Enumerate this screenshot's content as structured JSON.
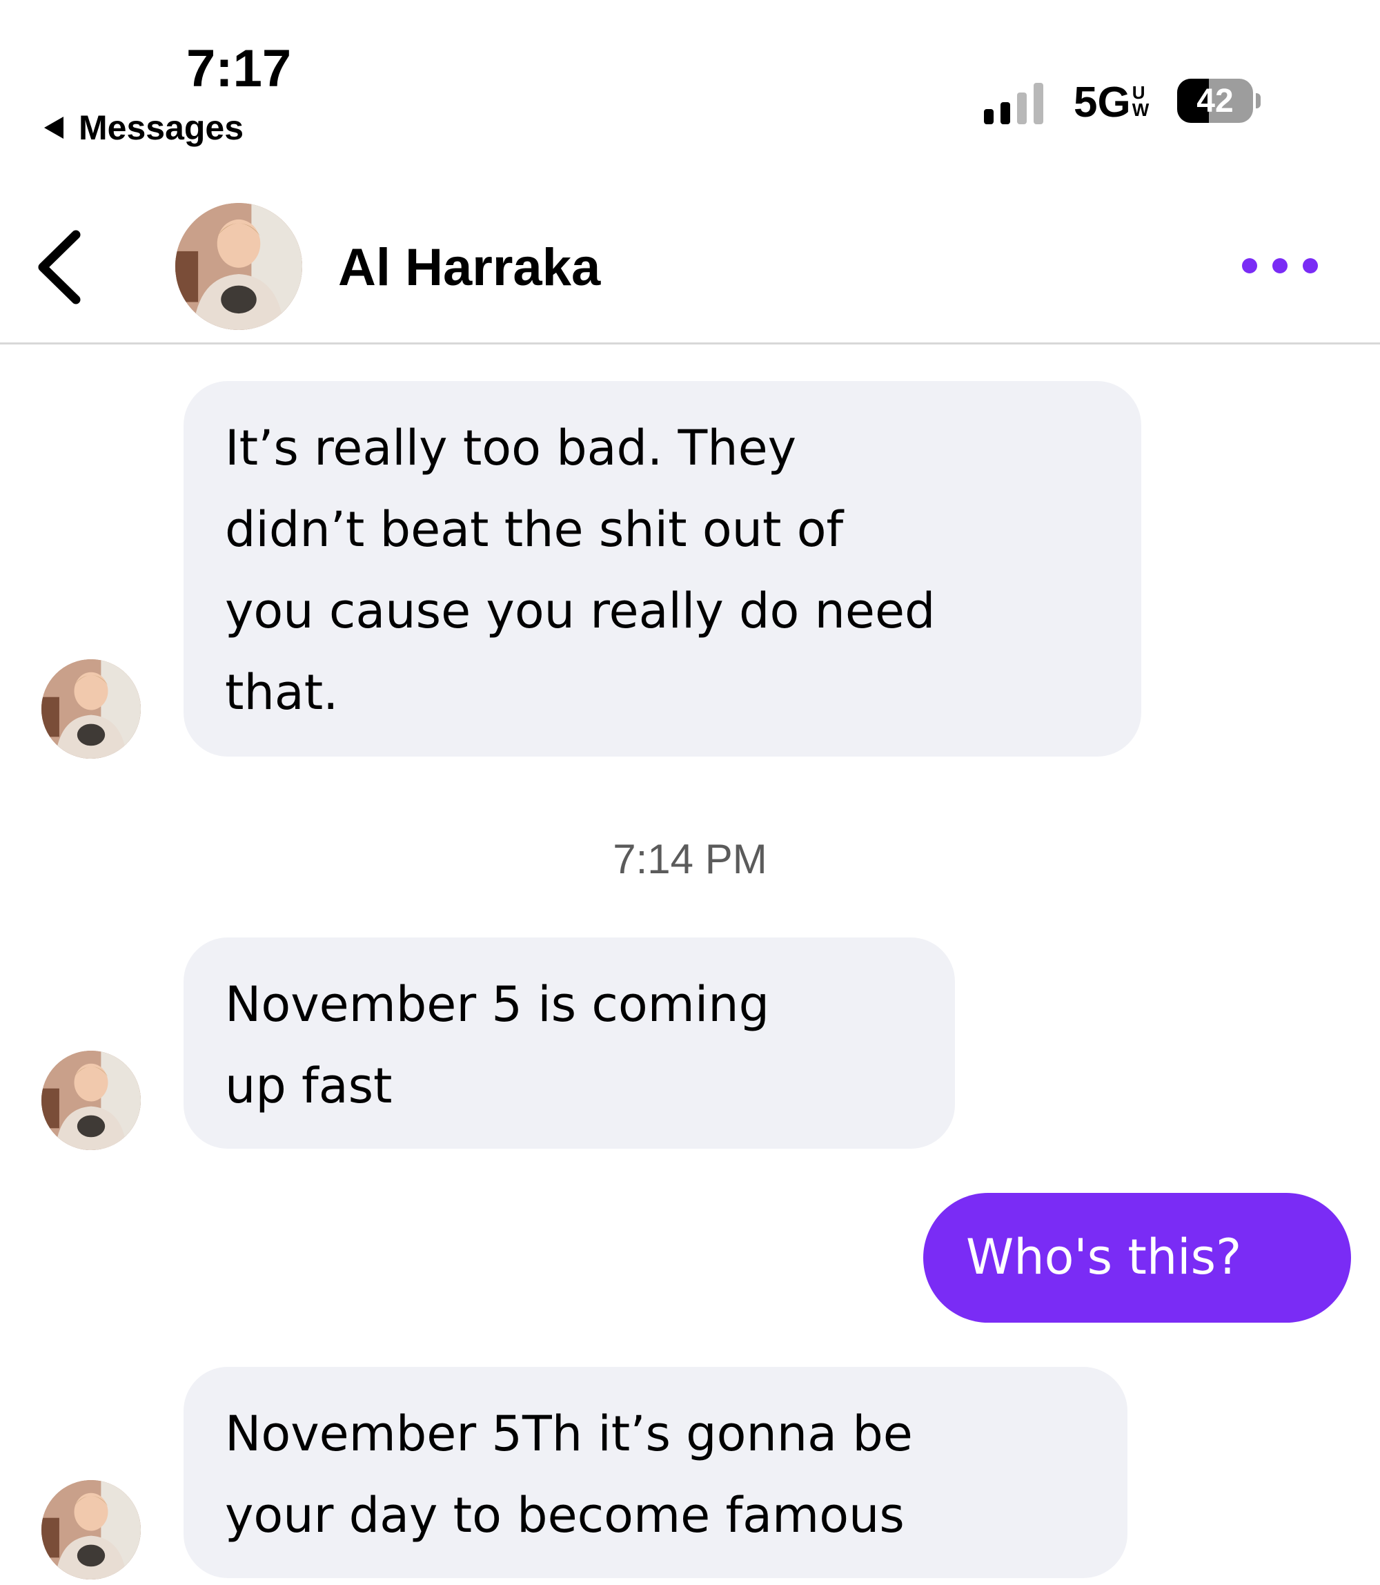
{
  "status_bar": {
    "time": "7:17",
    "back_to_app": "Messages",
    "network": "5G",
    "network_badge_top": "U",
    "network_badge_bottom": "W",
    "battery_level": "42",
    "battery_fraction": 0.42
  },
  "header": {
    "contact_name": "Al Harraka",
    "avatar_icon": "profile-photo",
    "back_icon": "chevron-left-icon",
    "more_icon": "more-dots-icon"
  },
  "conversation": {
    "messages": [
      {
        "direction": "incoming",
        "text": "It’s really too bad. They\ndidn’t beat the shit out of\nyou cause you really do need\nthat."
      },
      {
        "direction": "incoming",
        "text": "November 5 is coming\nup fast"
      },
      {
        "direction": "outgoing",
        "text": "Who's this?"
      },
      {
        "direction": "incoming",
        "text": "November 5Th it’s gonna be\nyour day to become famous"
      }
    ],
    "timestamp": "7:14 PM"
  },
  "colors": {
    "accent": "#7a2cf5",
    "incoming_bubble": "#f0f1f6",
    "divider": "#d8d8d8",
    "timestamp_text": "#5b5b5b"
  }
}
